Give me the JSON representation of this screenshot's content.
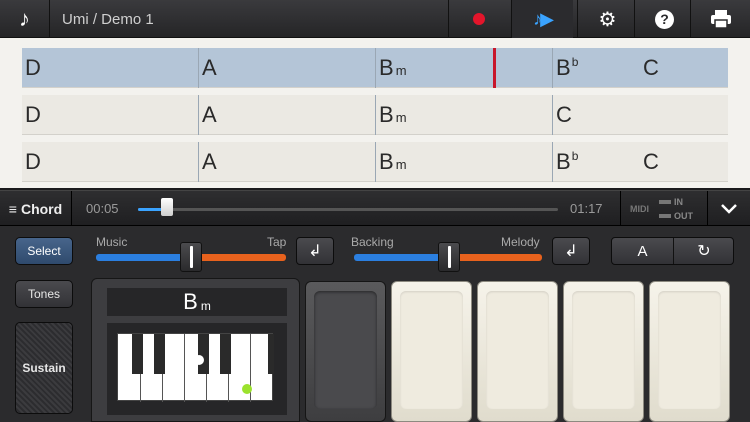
{
  "header": {
    "title": "Umi / Demo 1",
    "note_icon": "music-note-icon",
    "record_icon": "record-icon",
    "play_icon": "play-notes-icon",
    "settings_icon": "gear-icon",
    "help_icon": "help-icon",
    "print_icon": "printer-icon",
    "help_glyph": "?"
  },
  "sheet": {
    "rows": [
      {
        "selected": true,
        "bars": [
          {
            "root": "D"
          },
          {
            "root": "A"
          },
          {
            "root": "B",
            "suffix": "m"
          },
          {
            "root": "B",
            "sup": "b",
            "second": "C"
          }
        ]
      },
      {
        "selected": false,
        "bars": [
          {
            "root": "D"
          },
          {
            "root": "A"
          },
          {
            "root": "B",
            "suffix": "m"
          },
          {
            "root": "C"
          }
        ]
      },
      {
        "selected": false,
        "bars": [
          {
            "root": "D"
          },
          {
            "root": "A"
          },
          {
            "root": "B",
            "suffix": "m"
          },
          {
            "root": "B",
            "sup": "b",
            "second": "C"
          }
        ]
      }
    ]
  },
  "transport": {
    "mode_label": "Chord",
    "current_time": "00:05",
    "total_time": "01:17",
    "progress": 0.07,
    "midi_label": "MIDI",
    "midi_in": "IN",
    "midi_out": "OUT"
  },
  "controls": {
    "select_label": "Select",
    "tones_label": "Tones",
    "sustain_label": "Sustain",
    "mixer1": {
      "left": "Music",
      "right": "Tap",
      "level": 0.5
    },
    "mixer2": {
      "left": "Backing",
      "right": "Melody",
      "level": 0.5
    },
    "key_label": "A"
  },
  "chord_display": {
    "root": "B",
    "suffix": "m"
  },
  "colors": {
    "accent": "#3aa3ff",
    "record": "#e3152b",
    "selected_row": "#b4c5d7",
    "cursor": "#c8162a",
    "bass_dot": "#9be22d"
  }
}
